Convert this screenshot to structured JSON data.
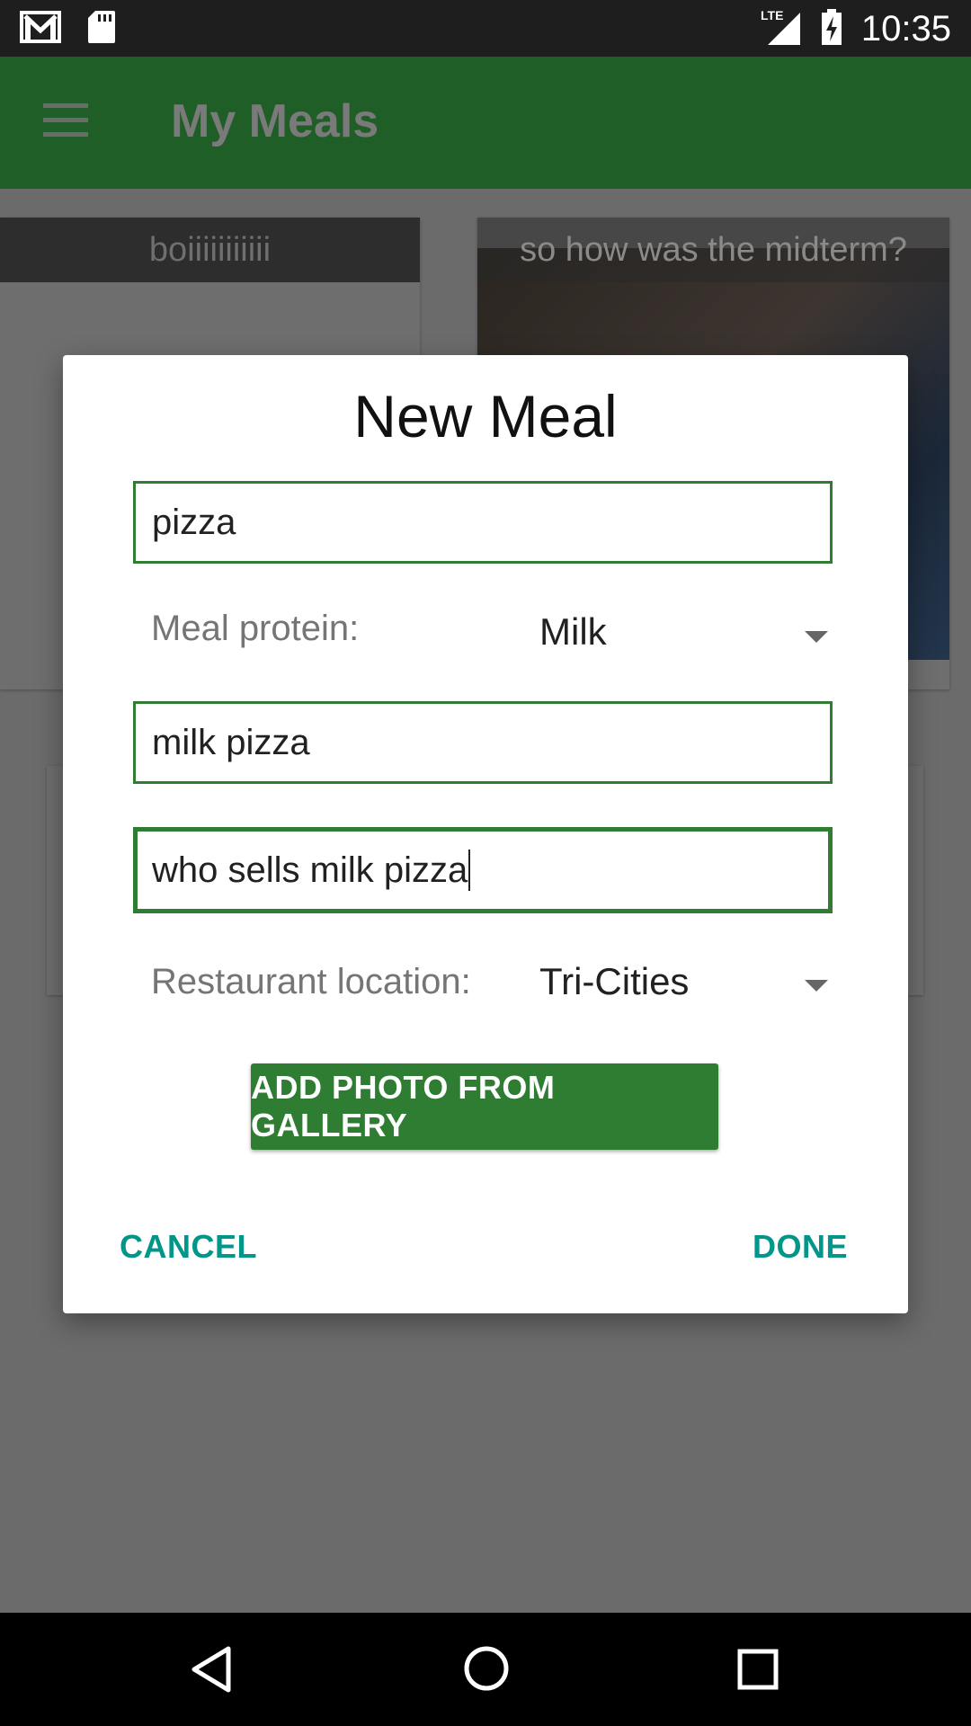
{
  "status_bar": {
    "time": "10:35",
    "icons": [
      "gmail-icon",
      "sd-card-icon",
      "lte-signal-icon",
      "battery-charging-icon"
    ],
    "network_label": "LTE"
  },
  "app_bar": {
    "title": "My Meals",
    "menu_icon": "hamburger-menu-icon"
  },
  "background_cards": [
    {
      "caption": "boiiiiiiiiiii"
    },
    {
      "caption": "so how was the midterm?"
    }
  ],
  "dialog": {
    "title": "New Meal",
    "meal_name_value": "pizza",
    "protein_label": "Meal protein:",
    "protein_value": "Milk",
    "meal_description_value": "milk pizza",
    "restaurant_value": "who sells milk pizza",
    "location_label": "Restaurant location:",
    "location_value": "Tri-Cities",
    "add_photo_label": "ADD PHOTO FROM GALLERY",
    "cancel_label": "CANCEL",
    "done_label": "DONE"
  },
  "colors": {
    "accent_green": "#2e7d32",
    "teal_text": "#00968a",
    "appbar_dim": "#1f5e27"
  },
  "nav_bar": {
    "icons": [
      "back-icon",
      "home-icon",
      "recents-icon"
    ]
  }
}
